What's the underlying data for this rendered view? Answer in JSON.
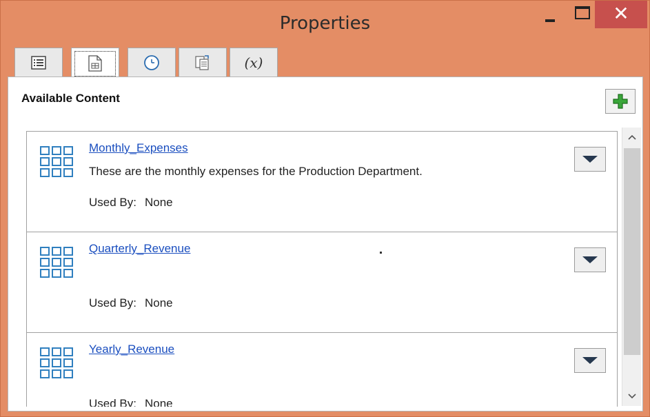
{
  "window": {
    "title": "Properties",
    "minimize_label": "–",
    "close_label": "✕"
  },
  "tabs": [
    {
      "icon": "list-icon"
    },
    {
      "icon": "table-icon",
      "active": true
    },
    {
      "icon": "clock-icon"
    },
    {
      "icon": "data-transfer-icon"
    },
    {
      "icon": "variable-icon",
      "label": "(x)"
    }
  ],
  "panel": {
    "title": "Available Content",
    "add_icon": "plus-icon"
  },
  "items": [
    {
      "name": "Monthly_Expenses",
      "description": "These are the monthly expenses for the Production Department.",
      "used_by_label": "Used By:",
      "used_by_value": "None"
    },
    {
      "name": "Quarterly_Revenue",
      "description": "",
      "used_by_label": "Used By:",
      "used_by_value": "None"
    },
    {
      "name": "Yearly_Revenue",
      "description": "",
      "used_by_label": "Used By:",
      "used_by_value": "None"
    }
  ],
  "colors": {
    "titlebar": "#e48d65",
    "close_button": "#c7504d",
    "link": "#1a4ebf",
    "plus_green": "#3aa63a",
    "grid_icon_blue": "#2f7fbf"
  }
}
